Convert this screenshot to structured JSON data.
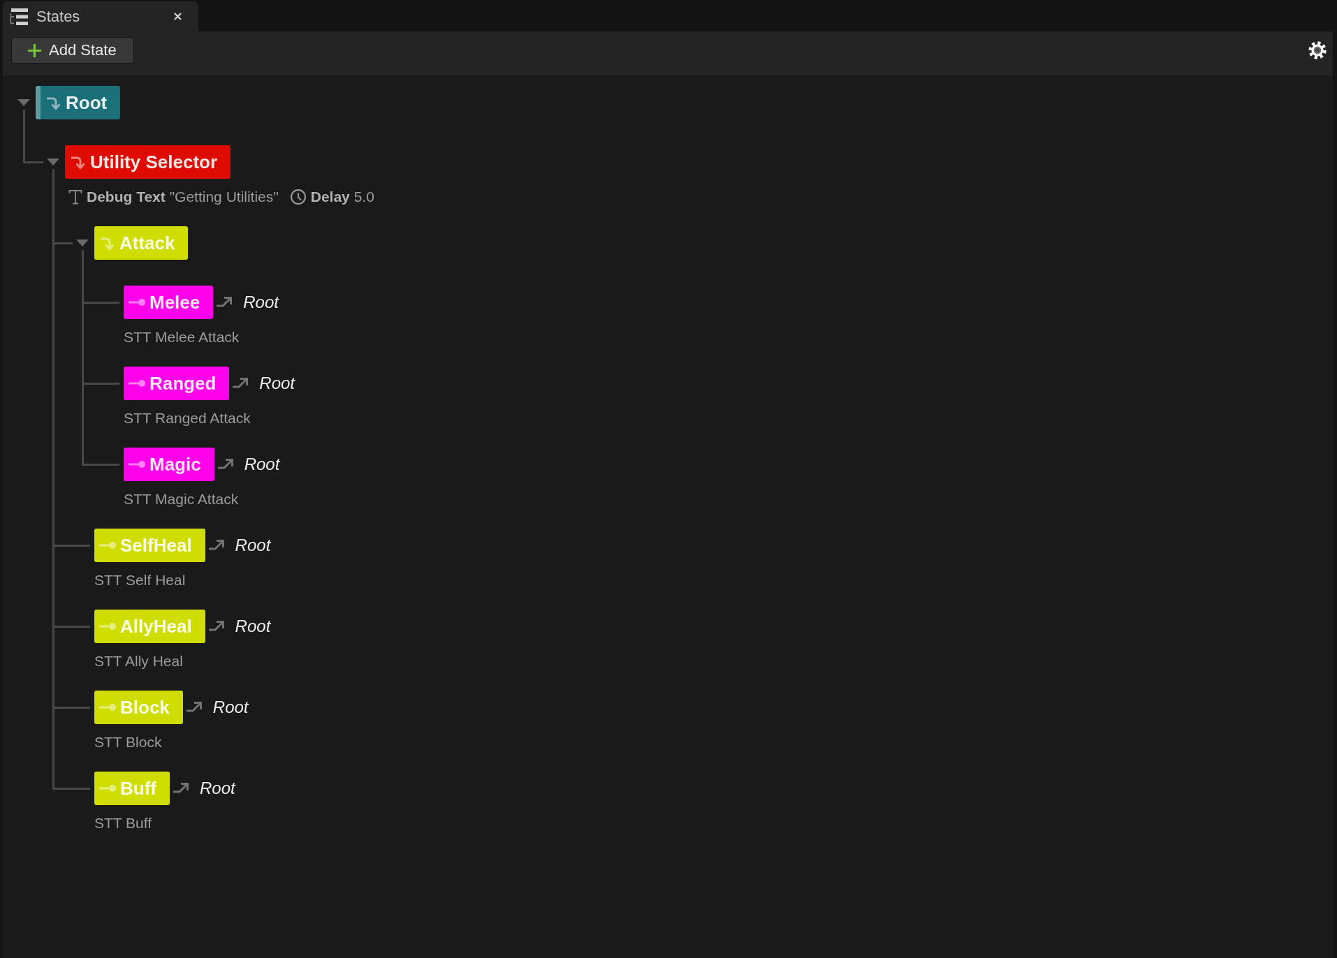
{
  "tab": {
    "title": "States"
  },
  "toolbar": {
    "add_button": "Add State"
  },
  "tree": [
    {
      "name": "Root",
      "kind": "selector",
      "color": "#1b6f78",
      "selected": true,
      "expanded": true,
      "children": [
        {
          "name": "Utility Selector",
          "kind": "selector",
          "color": "#dd0b00",
          "selected": false,
          "expanded": true,
          "tasks": [
            {
              "kind": "debug_text",
              "text": "**Debug Text** \"Getting Utilities\""
            },
            {
              "kind": "delay",
              "text": "**Delay** 5.0"
            }
          ],
          "children": [
            {
              "name": "Attack",
              "kind": "selector",
              "color": "#cfdd00",
              "selected": false,
              "expanded": true,
              "children": [
                {
                  "name": "Melee",
                  "kind": "state",
                  "color": "#ff00ea",
                  "selected": false,
                  "transition": "Root",
                  "tasks": [
                    {
                      "text": "STT Melee Attack"
                    }
                  ]
                },
                {
                  "name": "Ranged",
                  "kind": "state",
                  "color": "#ff00ea",
                  "selected": false,
                  "transition": "Root",
                  "tasks": [
                    {
                      "text": "STT Ranged Attack"
                    }
                  ]
                },
                {
                  "name": "Magic",
                  "kind": "state",
                  "color": "#ff00ea",
                  "selected": false,
                  "transition": "Root",
                  "tasks": [
                    {
                      "text": "STT Magic Attack"
                    }
                  ]
                }
              ]
            },
            {
              "name": "SelfHeal",
              "kind": "state",
              "color": "#cfdd00",
              "selected": false,
              "transition": "Root",
              "tasks": [
                {
                  "text": "STT Self Heal"
                }
              ]
            },
            {
              "name": "AllyHeal",
              "kind": "state",
              "color": "#cfdd00",
              "selected": false,
              "transition": "Root",
              "tasks": [
                {
                  "text": "STT Ally Heal"
                }
              ]
            },
            {
              "name": "Block",
              "kind": "state",
              "color": "#cfdd00",
              "selected": false,
              "transition": "Root",
              "tasks": [
                {
                  "text": "STT Block"
                }
              ]
            },
            {
              "name": "Buff",
              "kind": "state",
              "color": "#cfdd00",
              "selected": false,
              "transition": "Root",
              "tasks": [
                {
                  "text": "STT Buff"
                }
              ]
            }
          ]
        }
      ]
    }
  ]
}
